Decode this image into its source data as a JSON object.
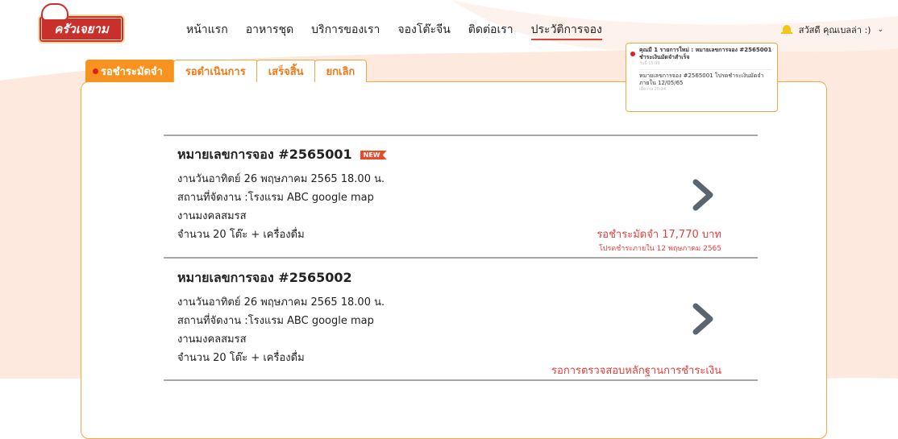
{
  "logo": {
    "text": "ครัวเจยาม"
  },
  "nav": {
    "items": [
      {
        "label": "หน้าแรก"
      },
      {
        "label": "อาหารชุด"
      },
      {
        "label": "บริการของเรา"
      },
      {
        "label": "จองโต๊ะจีน"
      },
      {
        "label": "ติดต่อเรา"
      },
      {
        "label": "ประวัติการจอง"
      }
    ],
    "active_index": 5
  },
  "user": {
    "greeting": "สวัสดี คุณเบลล่า :)",
    "bell_icon": "bell-icon",
    "chevron": "⌄"
  },
  "notification": {
    "title": "คุณมี 1 รายการใหม่ : หมายเลขการจอง #2565001 ชำระเงินมัดจำสำเร็จ",
    "title_time": "วันนี้ 15:09",
    "message": "หมายเลขการจอง #2565001 โปรดชำระเงินมัดจำภายใน 12/05/65",
    "message_time": "เมื่อวาน 20:14"
  },
  "tabs": [
    {
      "label": "รอชำระมัดจำ"
    },
    {
      "label": "รอดำเนินการ"
    },
    {
      "label": "เสร็จสิ้น"
    },
    {
      "label": "ยกเลิก"
    }
  ],
  "bookings": [
    {
      "title": "หมายเลขการจอง #2565001",
      "badge": "NEW",
      "date": "งานวันอาทิตย์ 26 พฤษภาคม 2565 18.00 น.",
      "venue": "สถานที่จัดงาน :โรงแรม ABC google map",
      "event": "งานมงคลสมรส",
      "qty": "จำนวน 20 โต๊ะ + เครื่องดื่ม",
      "status": "รอชำระมัดจำ 17,770 บาท",
      "status_sub": "โปรดชำระภายใน 12 พฤษภาคม 2565"
    },
    {
      "title": "หมายเลขการจอง #2565002",
      "date": "งานวันอาทิตย์ 26 พฤษภาคม 2565 18.00 น.",
      "venue": "สถานที่จัดงาน :โรงแรม ABC google map",
      "event": "งานมงคลสมรส",
      "qty": "จำนวน 20 โต๊ะ + เครื่องดื่ม",
      "status": "รอการตรวจสอบหลักฐานการชำระเงิน"
    }
  ],
  "colors": {
    "accent": "#f7931e",
    "red": "#e0413b",
    "wave": "#fde9de"
  }
}
